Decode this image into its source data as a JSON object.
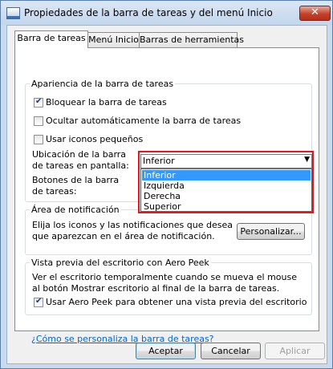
{
  "window": {
    "title": "Propiedades de la barra de tareas y del menú Inicio",
    "close_label": "✕"
  },
  "tabs": [
    {
      "label": "Barra de tareas",
      "active": true
    },
    {
      "label": "Menú Inicio",
      "active": false
    },
    {
      "label": "Barras de herramientas",
      "active": false
    }
  ],
  "appearance": {
    "title": "Apariencia de la barra de tareas",
    "lock_label": "Bloquear la barra de tareas",
    "lock_checked": true,
    "autohide_label": "Ocultar automáticamente la barra de tareas",
    "autohide_checked": false,
    "small_icons_label": "Usar iconos pequeños",
    "small_icons_checked": false,
    "location_label": "Ubicación de la barra de tareas en pantalla:",
    "buttons_label": "Botones de la barra de tareas:",
    "location_select": {
      "selected": "Inferior",
      "options": [
        "Inferior",
        "Izquierda",
        "Derecha",
        "Superior"
      ]
    }
  },
  "notification": {
    "title": "Área de notificación",
    "description": "Elija los iconos y las notificaciones que desea que aparezcan en el área de notificación.",
    "customize_button": "Personalizar..."
  },
  "aero_peek": {
    "title": "Vista previa del escritorio con Aero Peek",
    "description": "Ver el escritorio temporalmente cuando se mueva el mouse al botón Mostrar escritorio al final de la barra de tareas.",
    "use_label": "Usar Aero Peek para obtener una vista previa del escritorio",
    "use_checked": true
  },
  "help_link": "¿Cómo se personaliza la barra de tareas?",
  "buttons": {
    "accept": "Aceptar",
    "cancel": "Cancelar",
    "apply": "Aplicar"
  },
  "colors": {
    "highlight_box": "#e8141b",
    "selection": "#3399ff",
    "link": "#0066cc"
  }
}
